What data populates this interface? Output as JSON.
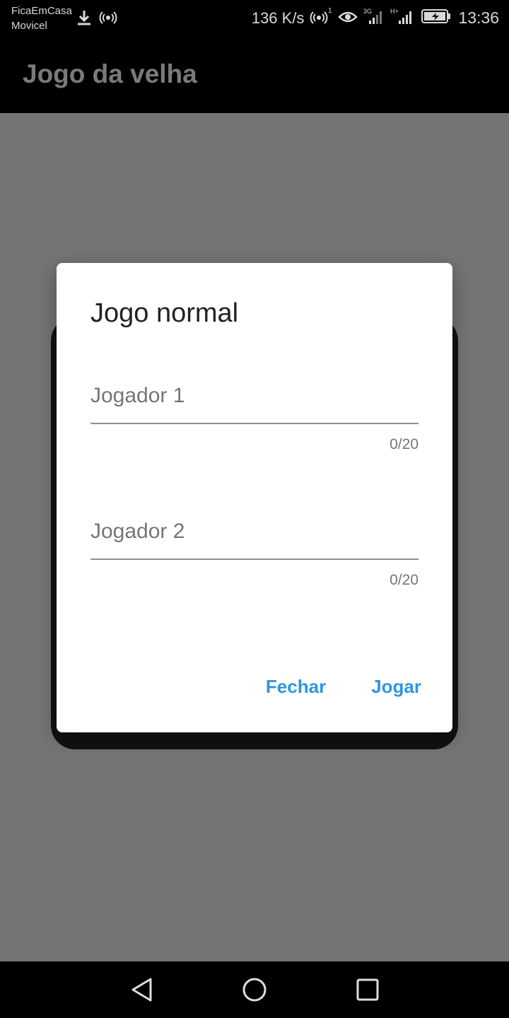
{
  "status_bar": {
    "carrier_line1": "FicaEmCasa",
    "carrier_line2": "Movicel",
    "speed": "136 K/s",
    "time": "13:36",
    "icons": [
      "download-icon",
      "hotspot-icon",
      "hotspot-1-icon",
      "eye-icon",
      "signal-3g-icon",
      "signal-h-plus-icon",
      "battery-charging-icon"
    ]
  },
  "app_bar": {
    "title": "Jogo da velha"
  },
  "dialog": {
    "title": "Jogo normal",
    "fields": [
      {
        "placeholder": "Jogador 1",
        "value": "",
        "counter": "0/20"
      },
      {
        "placeholder": "Jogador 2",
        "value": "",
        "counter": "0/20"
      }
    ],
    "close_label": "Fechar",
    "play_label": "Jogar"
  },
  "nav_bar": {
    "buttons": [
      "back-icon",
      "home-icon",
      "recents-icon"
    ]
  },
  "colors": {
    "accent": "#2f96e0",
    "scrim": "#757575",
    "bar": "#000000"
  }
}
